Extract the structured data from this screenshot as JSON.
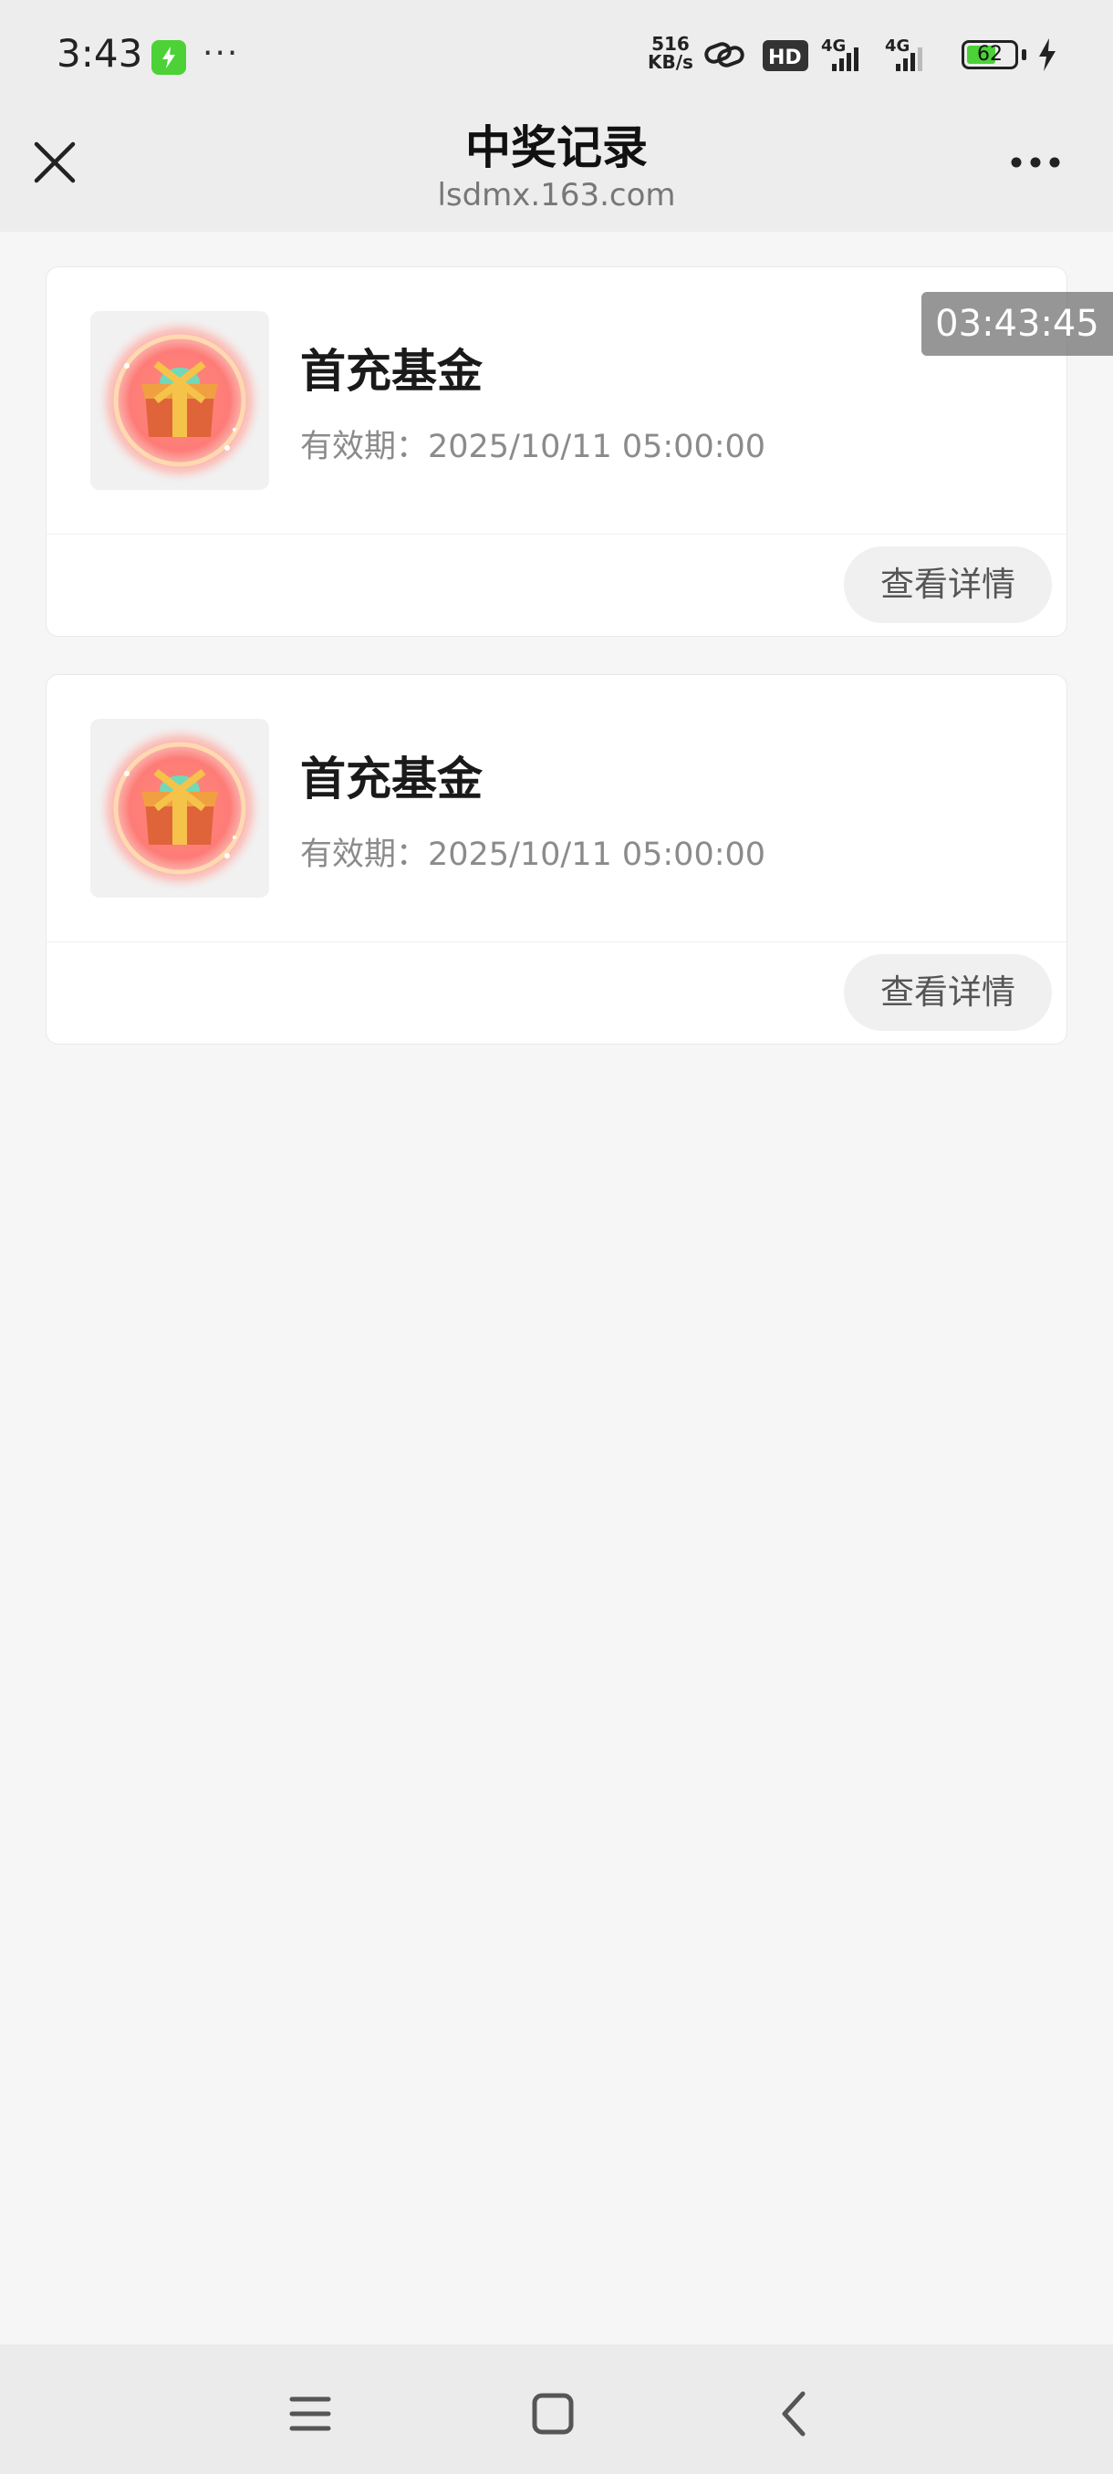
{
  "status_bar": {
    "time": "3:43",
    "more": "···",
    "net_speed_value": "516",
    "net_speed_unit": "KB/s",
    "hd_label": "HD",
    "signal1_label": "4G",
    "signal2_label": "4G",
    "battery_percent": 62,
    "battery_label": "62"
  },
  "nav": {
    "title": "中奖记录",
    "subtitle": "lsdmx.163.com",
    "close_icon": "close-icon",
    "more_icon": "more-dots-icon"
  },
  "timestamp_overlay": "03:43:45",
  "records": [
    {
      "name": "首充基金",
      "expiry": "有效期：2025/10/11 05:00:00",
      "button": "查看详情",
      "icon": "treasure-chest-icon"
    },
    {
      "name": "首充基金",
      "expiry": "有效期：2025/10/11 05:00:00",
      "button": "查看详情",
      "icon": "treasure-chest-icon"
    }
  ],
  "bottom_nav": {
    "menu_icon": "menu-icon",
    "home_icon": "home-icon",
    "back_icon": "back-icon"
  }
}
